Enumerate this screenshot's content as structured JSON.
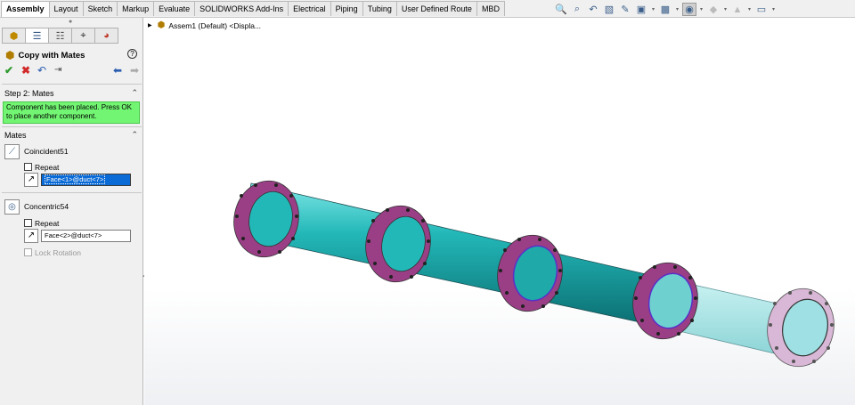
{
  "ribbon": {
    "tabs": [
      "Assembly",
      "Layout",
      "Sketch",
      "Markup",
      "Evaluate",
      "SOLIDWORKS Add-Ins",
      "Electrical",
      "Piping",
      "Tubing",
      "User Defined Route",
      "MBD"
    ],
    "active_tab": "Assembly"
  },
  "property_manager": {
    "title": "Copy with Mates",
    "help_label": "?",
    "step2": {
      "header": "Step 2: Mates",
      "message": "Component has been placed. Press OK to place another component."
    },
    "mates": {
      "header": "Mates",
      "items": [
        {
          "name": "Coincident51",
          "repeat_label": "Repeat",
          "selection": "Face<1>@duct<7>",
          "selected": true
        },
        {
          "name": "Concentric54",
          "repeat_label": "Repeat",
          "selection": "Face<2>@duct<7>",
          "selected": false
        }
      ],
      "lock_rotation_label": "Lock Rotation"
    }
  },
  "feature_tree": {
    "root_label": "Assem1 (Default) <Displa..."
  },
  "colors": {
    "pipe": "#1fb3b3",
    "flange": "#9a3f86",
    "message_bg": "#72f572",
    "selection_bg": "#0a6ad6"
  }
}
